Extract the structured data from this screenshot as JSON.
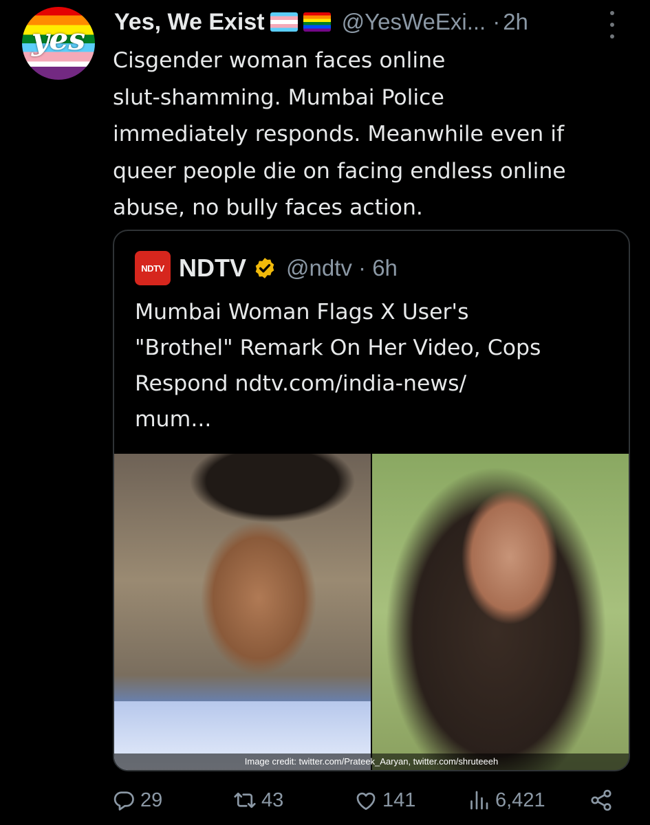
{
  "author": {
    "display_name": "Yes, We Exist",
    "avatar_text": "yes",
    "handle": "@YesWeExi...",
    "separator": "·",
    "time": "2h"
  },
  "tweet": {
    "text": "Cisgender woman faces online\nslut-shamming. Mumbai Police\nimmediately responds. Meanwhile even if\nqueer people die on facing endless online\nabuse, no bully faces action."
  },
  "quoted": {
    "logo_text": "NDTV",
    "name": "NDTV",
    "handle_time": "@ndtv · 6h",
    "text": "Mumbai Woman Flags X User's\n\"Brothel\" Remark On Her Video, Cops\nRespond ndtv.com/india-news/\nmum...",
    "image_caption": "Image credit: twitter.com/Prateek_Aaryan, twitter.com/shruteeeh"
  },
  "actions": {
    "replies": "29",
    "retweets": "43",
    "likes": "141",
    "views": "6,421"
  },
  "colors": {
    "background": "#000000",
    "text": "#e7e9ea",
    "muted": "#8b98a5",
    "border": "#2f3336",
    "verified_gold": "#f0b90b",
    "ndtv_red": "#d6261d"
  }
}
